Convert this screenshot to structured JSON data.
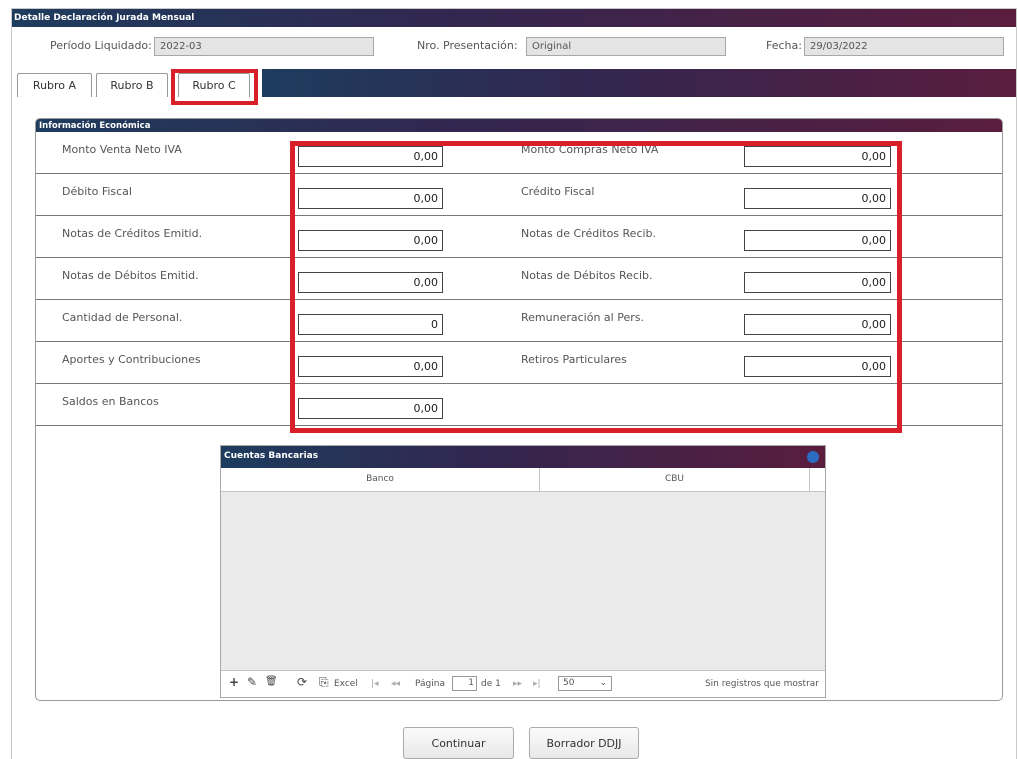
{
  "window": {
    "title": "Detalle Declaración Jurada Mensual"
  },
  "header": {
    "periodo_label": "Período Liquidado:",
    "periodo_value": "2022-03",
    "presentacion_label": "Nro. Presentación:",
    "presentacion_value": "Original",
    "fecha_label": "Fecha:",
    "fecha_value": "29/03/2022"
  },
  "tabs": [
    {
      "label": "Rubro A"
    },
    {
      "label": "Rubro B"
    },
    {
      "label": "Rubro C",
      "active": true
    }
  ],
  "info": {
    "title": "Información Económica",
    "rows": [
      {
        "left_label": "Monto Venta Neto IVA",
        "left_value": "0,00",
        "right_label": "Monto Compras Neto IVA",
        "right_value": "0,00"
      },
      {
        "left_label": "Débito Fiscal",
        "left_value": "0,00",
        "right_label": "Crédito Fiscal",
        "right_value": "0,00"
      },
      {
        "left_label": "Notas de Créditos Emitid.",
        "left_value": "0,00",
        "right_label": "Notas de Créditos Recib.",
        "right_value": "0,00"
      },
      {
        "left_label": "Notas de Débitos Emitid.",
        "left_value": "0,00",
        "right_label": "Notas de Débitos Recib.",
        "right_value": "0,00"
      },
      {
        "left_label": "Cantidad de Personal.",
        "left_value": "0",
        "right_label": "Remuneración al Pers.",
        "right_value": "0,00"
      },
      {
        "left_label": "Aportes y Contribuciones",
        "left_value": "0,00",
        "right_label": "Retiros Particulares",
        "right_value": "0,00"
      },
      {
        "left_label": "Saldos en Bancos",
        "left_value": "0,00"
      }
    ]
  },
  "bank_grid": {
    "title": "Cuentas Bancarias",
    "columns": [
      "Banco",
      "CBU"
    ],
    "toolbar": {
      "add_icon": "+",
      "edit_icon": "✎",
      "delete_icon": "🗑",
      "refresh_icon": "⟳",
      "excel_icon": "⎘",
      "excel_label": "Excel",
      "first_icon": "|◂",
      "prev_icon": "◂◂",
      "page_label": "Página",
      "page_value": "1",
      "of_label": "de 1",
      "next_icon": "▸▸",
      "last_icon": "▸|",
      "page_size": "50",
      "empty_message": "Sin registros que mostrar"
    }
  },
  "actions": {
    "continue_label": "Continuar",
    "draft_label": "Borrador DDJJ"
  },
  "colors": {
    "header_gradient": [
      "#1d3c5e",
      "#33264f",
      "#5a1d3e"
    ],
    "highlight": "#d8202a",
    "collapse_dot": "#2a6cc0"
  }
}
